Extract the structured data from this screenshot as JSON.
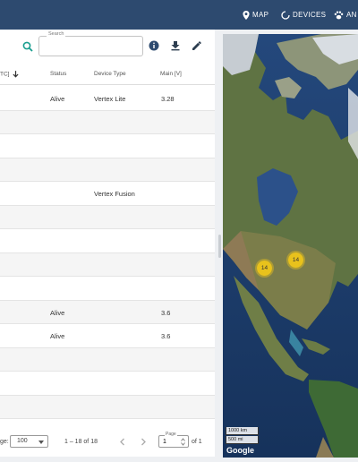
{
  "nav": {
    "map_label": "MAP",
    "devices_label": "DEVICES",
    "analytics_label": "AN"
  },
  "search": {
    "label": "Search",
    "value": ""
  },
  "columns": {
    "time": "TC]",
    "status": "Status",
    "device_type": "Device Type",
    "main": "Main [V]"
  },
  "rows": [
    {
      "status": "Alive",
      "device_type": "Vertex Lite",
      "main": "3.28"
    },
    {
      "status": "",
      "device_type": "",
      "main": ""
    },
    {
      "status": "",
      "device_type": "",
      "main": ""
    },
    {
      "status": "",
      "device_type": "",
      "main": ""
    },
    {
      "status": "",
      "device_type": "Vertex Fusion",
      "main": ""
    },
    {
      "status": "",
      "device_type": "",
      "main": ""
    },
    {
      "status": "",
      "device_type": "",
      "main": ""
    },
    {
      "status": "",
      "device_type": "",
      "main": ""
    },
    {
      "status": "",
      "device_type": "",
      "main": ""
    },
    {
      "status": "Alive",
      "device_type": "",
      "main": "3.6"
    },
    {
      "status": "Alive",
      "device_type": "",
      "main": "3.6"
    },
    {
      "status": "",
      "device_type": "",
      "main": ""
    },
    {
      "status": "",
      "device_type": "",
      "main": ""
    },
    {
      "status": "",
      "device_type": "",
      "main": ""
    }
  ],
  "pagination": {
    "per_page_label": "ge:",
    "per_page_value": "100",
    "range_text": "1 – 18 of 18",
    "page_label": "Page",
    "page_value": "1",
    "page_of": "of 1"
  },
  "map": {
    "clusters": [
      {
        "label": "14"
      },
      {
        "label": "14"
      }
    ],
    "scale_km": "1000 km",
    "scale_mi": "500 mi",
    "attribution": "Google"
  },
  "colors": {
    "topbar": "#2d4a6f",
    "search_icon": "#1a9e8f",
    "cluster": "#e8c21c"
  },
  "icons": {
    "map": "map-pin-icon",
    "devices": "loading-ring-icon",
    "analytics": "paw-icon",
    "search": "search-icon",
    "info": "info-icon",
    "download": "download-icon",
    "edit": "pencil-icon",
    "sort": "arrow-down-icon"
  }
}
